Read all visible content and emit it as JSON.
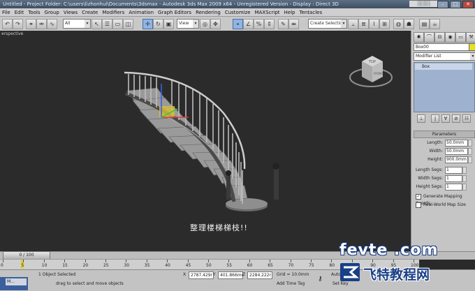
{
  "title_bar": {
    "title": "Untitled    - Project Folder: C:\\users\\lizhonhui\\Documents\\3dsmax        - Autodesk 3ds Max  2009 x64    - Unregistered Version        - Display : Direct 3D"
  },
  "menu": [
    "File",
    "Edit",
    "Tools",
    "Group",
    "Views",
    "Create",
    "Modifiers",
    "Animation",
    "Graph Editors",
    "Rendering",
    "Customize",
    "MAXScript",
    "Help",
    "Tentacles"
  ],
  "toolbar": {
    "selection_filter": "All",
    "ref_coord": "View",
    "named_selection": "Create Selection Se"
  },
  "viewport": {
    "label": "erspective",
    "caption": "整理楼梯梯枝!!",
    "viewcube": {
      "top": "TOP",
      "front": "FRONT"
    }
  },
  "command_panel": {
    "object_name": "Box00",
    "object_color": "#e8e020",
    "modifier_list_label": "Modifier List",
    "stack_item": "Box",
    "rollout_title": "Parameters",
    "params": [
      {
        "label": "Length:",
        "value": "50.0mm"
      },
      {
        "label": "Width:",
        "value": "50.0mm"
      },
      {
        "label": "Height:",
        "value": "900.0mm"
      }
    ],
    "segs": [
      {
        "label": "Length Segs:",
        "value": "1"
      },
      {
        "label": "Width Segs:",
        "value": "1"
      },
      {
        "label": "Height Segs:",
        "value": "1"
      }
    ],
    "gen_mapping": "Generate Mapping Coords.",
    "real_world": "Real-World Map Size"
  },
  "timeline": {
    "slider_label": "0 / 100",
    "ticks": [
      "0",
      "5",
      "10",
      "15",
      "20",
      "25",
      "30",
      "35",
      "40",
      "45",
      "50",
      "55",
      "60",
      "65",
      "70",
      "75",
      "80",
      "85",
      "90",
      "95",
      "100"
    ]
  },
  "status": {
    "selection": "1 Object Selected",
    "prompt": "drag to select and move objects",
    "x": "2787.429r",
    "y": "401.866mm",
    "z": "2284.222r",
    "grid": "Grid = 10.0mm",
    "auto_key": "Auto Key",
    "set_key": "Set Key",
    "add_time_tag": "Add Time Tag",
    "task_label": "M..."
  },
  "watermark": {
    "line1": "fevte .com",
    "line2": "飞特教程网"
  }
}
